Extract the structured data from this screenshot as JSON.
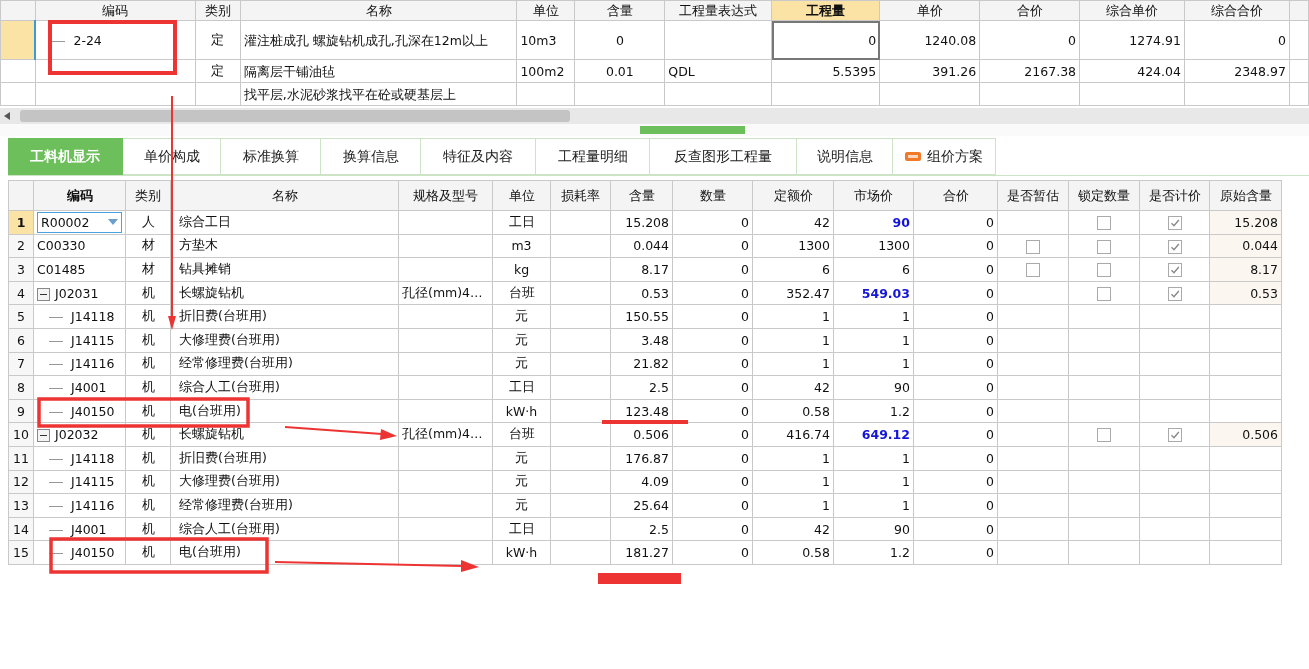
{
  "top_table": {
    "columns": [
      {
        "label": "编码",
        "selected": false
      },
      {
        "label": "类别",
        "selected": false
      },
      {
        "label": "名称",
        "selected": false
      },
      {
        "label": "单位",
        "selected": false
      },
      {
        "label": "含量",
        "selected": false
      },
      {
        "label": "工程量表达式",
        "selected": false
      },
      {
        "label": "工程量",
        "selected": true
      },
      {
        "label": "单价",
        "selected": false
      },
      {
        "label": "合价",
        "selected": false
      },
      {
        "label": "综合单价",
        "selected": false
      },
      {
        "label": "综合合价",
        "selected": false
      }
    ],
    "rows": [
      {
        "selected": true,
        "code": "2-24",
        "type": "定",
        "name": "灌注桩成孔 螺旋钻机成孔,孔深在12m以上",
        "unit": "10m3",
        "content": "0",
        "quantity": "0",
        "price": "1240.08",
        "total": "0",
        "unit_price": "1274.91",
        "sum": "0"
      },
      {
        "selected": false,
        "type": "定",
        "name": "隔离层干铺油毡",
        "unit": "100m2",
        "content": "0.01",
        "expr": "QDL",
        "quantity": "5.5395",
        "price": "391.26",
        "total": "2167.38",
        "unit_price": "424.04",
        "sum": "2348.97"
      },
      {
        "selected": false,
        "name": "找平层,水泥砂浆找平在砼或硬基层上"
      }
    ]
  },
  "tabs": [
    {
      "label": "工料机显示",
      "selected": true
    },
    {
      "label": "单价构成",
      "selected": false
    },
    {
      "label": "标准换算",
      "selected": false
    },
    {
      "label": "换算信息",
      "selected": false
    },
    {
      "label": "特征及内容",
      "selected": false
    },
    {
      "label": "工程量明细",
      "selected": false
    },
    {
      "label": "反查图形工程量",
      "selected": false
    },
    {
      "label": "说明信息",
      "selected": false
    },
    {
      "label": "组价方案",
      "selected": false,
      "kind": "new"
    }
  ],
  "lower_table": {
    "columns": [
      {
        "label": "编码",
        "selected": true
      },
      {
        "label": "类别",
        "selected": false
      },
      {
        "label": "名称",
        "selected": false
      },
      {
        "label": "规格及型号",
        "selected": false
      },
      {
        "label": "单位",
        "selected": false
      },
      {
        "label": "损耗率",
        "selected": false
      },
      {
        "label": "含量",
        "selected": false
      },
      {
        "label": "数量",
        "selected": false
      },
      {
        "label": "定额价",
        "selected": false
      },
      {
        "label": "市场价",
        "selected": false
      },
      {
        "label": "合价",
        "selected": false
      },
      {
        "label": "是否暂估",
        "selected": false
      },
      {
        "label": "锁定数量",
        "selected": false
      },
      {
        "label": "是否计价",
        "selected": false
      },
      {
        "label": "原始含量",
        "selected": false
      }
    ],
    "rows": [
      {
        "num": "1",
        "selected": true,
        "code": "R00002",
        "type": "人",
        "name": "综合工日",
        "unit": "工日",
        "content": "15.208",
        "qty": "0",
        "base_price": "42",
        "market_price": "90",
        "emphasis": true,
        "total": "0",
        "locked": false,
        "priced": true,
        "original": "15.208"
      },
      {
        "num": "2",
        "selected": false,
        "code": "C00330",
        "type": "材",
        "name": "方垫木",
        "unit": "m3",
        "content": "0.044",
        "qty": "0",
        "base_price": "1300",
        "market_price": "1300",
        "emphasis": false,
        "total": "0",
        "provisional": false,
        "locked": false,
        "priced": true,
        "original": "0.044"
      },
      {
        "num": "3",
        "selected": false,
        "code": "C01485",
        "type": "材",
        "name": "钻具摊销",
        "unit": "kg",
        "content": "8.17",
        "qty": "0",
        "base_price": "6",
        "market_price": "6",
        "emphasis": false,
        "total": "0",
        "provisional": false,
        "locked": false,
        "priced": true,
        "original": "8.17"
      },
      {
        "num": "4",
        "selected": false,
        "expanded": true,
        "code": "J02031",
        "type": "机",
        "name": "长螺旋钻机",
        "spec": "孔径(mm)4…",
        "unit": "台班",
        "content": "0.53",
        "qty": "0",
        "base_price": "352.47",
        "market_price": "549.03",
        "emphasis": true,
        "total": "0",
        "locked": false,
        "priced": true,
        "original": "0.53",
        "children": [
          {
            "num": "5",
            "selected": false,
            "code": "J14118",
            "type": "机",
            "name": "折旧费(台班用)",
            "unit": "元",
            "content": "150.55",
            "qty": "0",
            "base_price": "1",
            "market_price": "1",
            "emphasis": false,
            "total": "0"
          },
          {
            "num": "6",
            "selected": false,
            "code": "J14115",
            "type": "机",
            "name": "大修理费(台班用)",
            "unit": "元",
            "content": "3.48",
            "qty": "0",
            "base_price": "1",
            "market_price": "1",
            "emphasis": false,
            "total": "0"
          },
          {
            "num": "7",
            "selected": false,
            "code": "J14116",
            "type": "机",
            "name": "经常修理费(台班用)",
            "unit": "元",
            "content": "21.82",
            "qty": "0",
            "base_price": "1",
            "market_price": "1",
            "emphasis": false,
            "total": "0"
          },
          {
            "num": "8",
            "selected": false,
            "code": "J4001",
            "type": "机",
            "name": "综合人工(台班用)",
            "unit": "工日",
            "content": "2.5",
            "qty": "0",
            "base_price": "42",
            "market_price": "90",
            "emphasis": false,
            "total": "0"
          },
          {
            "num": "9",
            "selected": false,
            "code": "J40150",
            "type": "机",
            "name": "电(台班用)",
            "unit": "kW·h",
            "content": "123.48",
            "qty": "0",
            "base_price": "0.58",
            "market_price": "1.2",
            "emphasis": false,
            "total": "0"
          }
        ]
      },
      {
        "num": "10",
        "selected": false,
        "expanded": true,
        "code": "J02032",
        "type": "机",
        "name": "长螺旋钻机",
        "spec": "孔径(mm)4…",
        "unit": "台班",
        "content": "0.506",
        "qty": "0",
        "base_price": "416.74",
        "market_price": "649.12",
        "emphasis": true,
        "total": "0",
        "locked": false,
        "priced": true,
        "original": "0.506",
        "children": [
          {
            "num": "11",
            "selected": false,
            "code": "J14118",
            "type": "机",
            "name": "折旧费(台班用)",
            "unit": "元",
            "content": "176.87",
            "qty": "0",
            "base_price": "1",
            "market_price": "1",
            "emphasis": false,
            "total": "0"
          },
          {
            "num": "12",
            "selected": false,
            "code": "J14115",
            "type": "机",
            "name": "大修理费(台班用)",
            "unit": "元",
            "content": "4.09",
            "qty": "0",
            "base_price": "1",
            "market_price": "1",
            "emphasis": false,
            "total": "0"
          },
          {
            "num": "13",
            "selected": false,
            "code": "J14116",
            "type": "机",
            "name": "经常修理费(台班用)",
            "unit": "元",
            "content": "25.64",
            "qty": "0",
            "base_price": "1",
            "market_price": "1",
            "emphasis": false,
            "total": "0"
          },
          {
            "num": "14",
            "selected": false,
            "code": "J4001",
            "type": "机",
            "name": "综合人工(台班用)",
            "unit": "工日",
            "content": "2.5",
            "qty": "0",
            "base_price": "42",
            "market_price": "90",
            "emphasis": false,
            "total": "0"
          },
          {
            "num": "15",
            "selected": false,
            "code": "J40150",
            "type": "机",
            "name": "电(台班用)",
            "unit": "kW·h",
            "content": "181.27",
            "qty": "0",
            "base_price": "0.58",
            "market_price": "1.2",
            "emphasis": false,
            "total": "0"
          }
        ]
      }
    ]
  }
}
